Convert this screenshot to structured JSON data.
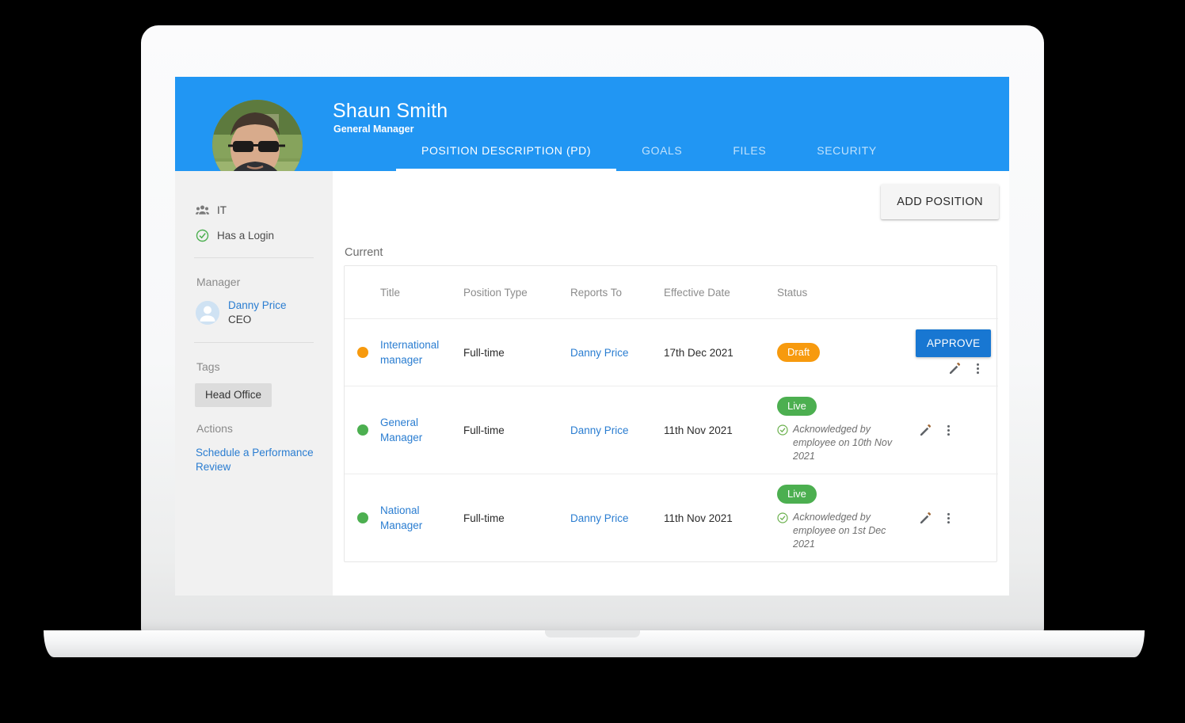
{
  "header": {
    "person_name": "Shaun Smith",
    "person_role": "General Manager",
    "tabs": [
      {
        "label": "POSITION DESCRIPTION (PD)",
        "active": true
      },
      {
        "label": "GOALS",
        "active": false
      },
      {
        "label": "FILES",
        "active": false
      },
      {
        "label": "SECURITY",
        "active": false
      }
    ],
    "avatar_icon": "user-photo",
    "brand_color": "#2196f3"
  },
  "sidebar": {
    "department": "IT",
    "login_status": "Has a Login",
    "manager_heading": "Manager",
    "manager": {
      "name": "Danny Price",
      "title": "CEO"
    },
    "tags_heading": "Tags",
    "tags": [
      "Head Office"
    ],
    "actions_heading": "Actions",
    "actions": [
      "Schedule a Performance Review"
    ]
  },
  "content": {
    "add_position_label": "ADD POSITION",
    "section_label": "Current",
    "columns": [
      "",
      "Title",
      "Position Type",
      "Reports To",
      "Effective Date",
      "Status",
      ""
    ],
    "rows": [
      {
        "dot_color": "orange",
        "title": "International manager",
        "position_type": "Full-time",
        "reports_to": "Danny Price",
        "effective_date": "17th Dec 2021",
        "status": "Draft",
        "status_kind": "draft",
        "acknowledgement": "",
        "approve_label": "APPROVE",
        "has_approve": true
      },
      {
        "dot_color": "green",
        "title": "General Manager",
        "position_type": "Full-time",
        "reports_to": "Danny Price",
        "effective_date": "11th Nov 2021",
        "status": "Live",
        "status_kind": "live",
        "acknowledgement": "Acknowledged by employee on 10th Nov 2021",
        "approve_label": "",
        "has_approve": false
      },
      {
        "dot_color": "green",
        "title": "National Manager",
        "position_type": "Full-time",
        "reports_to": "Danny Price",
        "effective_date": "11th Nov 2021",
        "status": "Live",
        "status_kind": "live",
        "acknowledgement": "Acknowledged by employee on 1st Dec 2021",
        "approve_label": "",
        "has_approve": false
      }
    ],
    "row_icons": {
      "edit": "pencil-icon",
      "more": "more-vertical-icon"
    }
  },
  "colors": {
    "header_blue": "#2196f3",
    "approve_blue": "#1877d2",
    "draft_orange": "#f79a0e",
    "live_green": "#4caf50",
    "link_blue": "#2a7dd1",
    "sidebar_grey": "#f1f1f1"
  }
}
